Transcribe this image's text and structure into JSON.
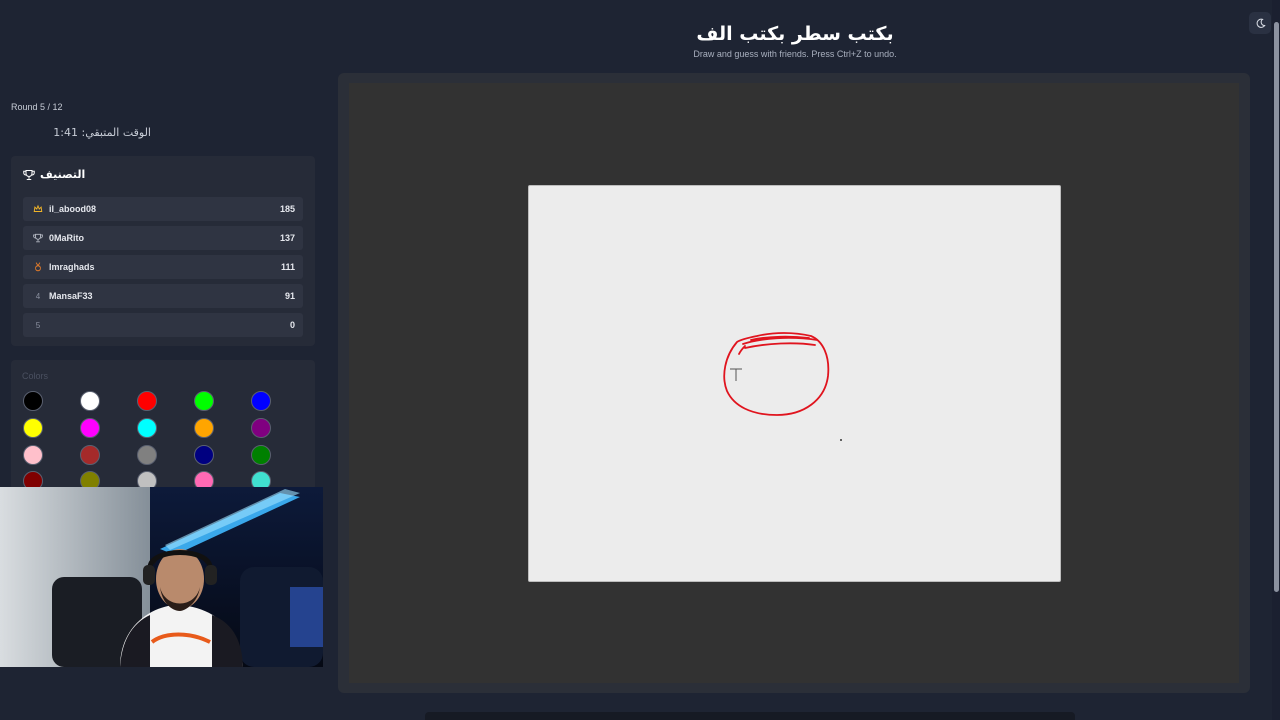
{
  "header": {
    "title": "بكتب سطر بكتب الف",
    "subtitle": "Draw and guess with friends. Press Ctrl+Z to undo."
  },
  "theme_toggle": {
    "icon": "moon-icon"
  },
  "game": {
    "round": "Round 5 / 12",
    "timer": "الوقت المتبقي: 1:41"
  },
  "leaderboard": {
    "title": "التصنيف",
    "icon": "trophy-icon",
    "players": [
      {
        "rank": "1",
        "rank_icon": "crown-icon",
        "name": "il_abood08",
        "score": "185"
      },
      {
        "rank": "2",
        "rank_icon": "trophy-icon",
        "name": "0MaRito",
        "score": "137"
      },
      {
        "rank": "3",
        "rank_icon": "medal-icon",
        "name": "lmraghads",
        "score": "111"
      },
      {
        "rank": "4",
        "rank_icon": "",
        "name": "MansaF33",
        "score": "91"
      },
      {
        "rank": "5",
        "rank_icon": "",
        "name": "",
        "score": "0"
      }
    ]
  },
  "palette": {
    "label": "Colors",
    "colors": [
      "#000000",
      "#ffffff",
      "#ff0000",
      "#00ff00",
      "#0000ff",
      "#ffff00",
      "#ff00ff",
      "#00ffff",
      "#ffa500",
      "#800080",
      "#ffc0cb",
      "#a52a2a",
      "#808080",
      "#000080",
      "#008000",
      "#800000",
      "#808000",
      "#c0c0c0",
      "#ff69b4",
      "#40e0d0"
    ]
  },
  "canvas": {
    "stroke_color": "#e0141e",
    "cursor": "crosshair-icon"
  },
  "webcam": {
    "description_icon": "webcam-feed"
  }
}
